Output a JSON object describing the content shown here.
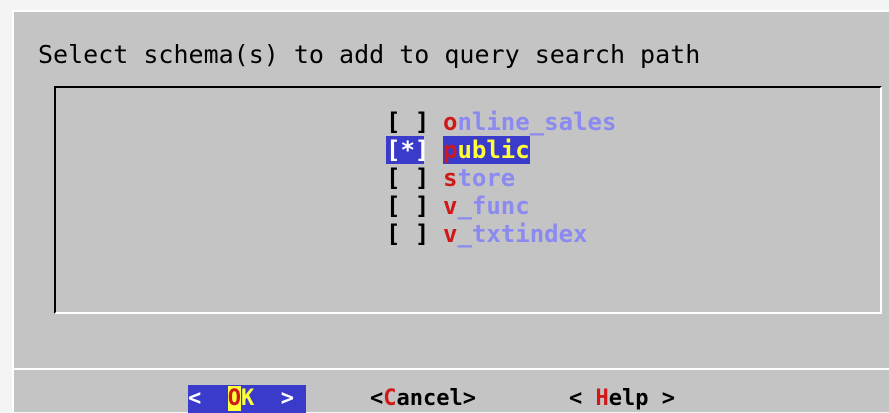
{
  "dialog": {
    "title": "Select schema(s) to add to query search path"
  },
  "schemas": [
    {
      "checkbox": "[ ]",
      "hot": "o",
      "rest": "nline_sales",
      "checked": false,
      "selected": false
    },
    {
      "checkbox": "[*]",
      "hot": "p",
      "rest": "ublic",
      "checked": true,
      "selected": true
    },
    {
      "checkbox": "[ ]",
      "hot": "s",
      "rest": "tore",
      "checked": false,
      "selected": false
    },
    {
      "checkbox": "[ ]",
      "hot": "v",
      "rest": "_func",
      "checked": false,
      "selected": false
    },
    {
      "checkbox": "[ ]",
      "hot": "v",
      "rest": "_txtindex",
      "checked": false,
      "selected": false
    }
  ],
  "buttons": {
    "ok": {
      "left": "<  ",
      "hot": "O",
      "rest": "K",
      "right": "  >"
    },
    "cancel": {
      "left": "<",
      "hot": "C",
      "rest": "ancel",
      "right": ">"
    },
    "help": {
      "left": "< ",
      "hot": "H",
      "rest": "elp",
      "right": " >"
    }
  },
  "colors": {
    "dialog_bg": "#c4c4c4",
    "selection_bg": "#3a3acb",
    "item_text": "#8a8af0",
    "hotkey": "#d01818",
    "selected_text": "#ffff3a"
  }
}
